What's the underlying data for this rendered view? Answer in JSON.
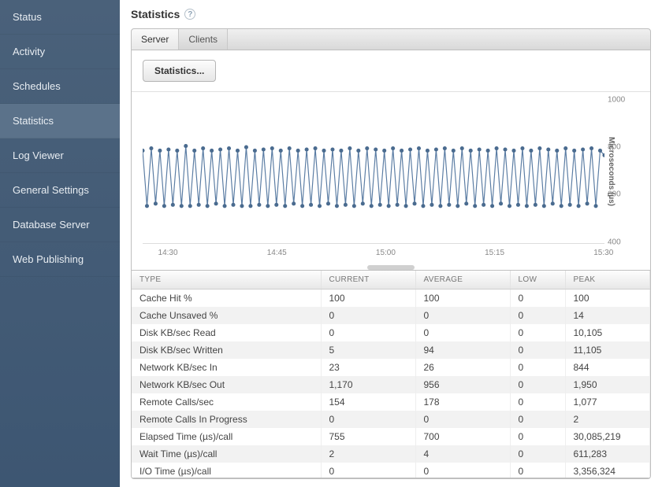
{
  "sidebar": {
    "items": [
      {
        "label": "Status"
      },
      {
        "label": "Activity"
      },
      {
        "label": "Schedules"
      },
      {
        "label": "Statistics",
        "active": true
      },
      {
        "label": "Log Viewer"
      },
      {
        "label": "General Settings"
      },
      {
        "label": "Database Server"
      },
      {
        "label": "Web Publishing"
      }
    ]
  },
  "page": {
    "title": "Statistics"
  },
  "tabs": [
    {
      "label": "Server",
      "active": true
    },
    {
      "label": "Clients"
    }
  ],
  "toolbar": {
    "stats_button": "Statistics..."
  },
  "chart_data": {
    "type": "line",
    "ylabel": "Microseconds (µs)",
    "ylim": [
      400,
      1000
    ],
    "yticks": [
      400,
      600,
      800,
      1000
    ],
    "x_ticks": [
      "14:30",
      "14:45",
      "15:00",
      "15:15",
      "15:30"
    ],
    "values": [
      780,
      540,
      790,
      550,
      780,
      540,
      785,
      545,
      780,
      540,
      800,
      540,
      780,
      545,
      790,
      540,
      780,
      550,
      785,
      540,
      790,
      545,
      780,
      540,
      795,
      540,
      780,
      545,
      785,
      540,
      790,
      545,
      780,
      540,
      790,
      550,
      780,
      540,
      785,
      545,
      790,
      540,
      780,
      550,
      785,
      540,
      780,
      545,
      790,
      540,
      780,
      550,
      790,
      540,
      785,
      545,
      780,
      540,
      790,
      545,
      780,
      540,
      785,
      550,
      790,
      540,
      780,
      545,
      785,
      540,
      790,
      545,
      780,
      540,
      790,
      550,
      780,
      540,
      785,
      545,
      780,
      540,
      790,
      550,
      785,
      540,
      780,
      545,
      790,
      540,
      780,
      545,
      790,
      540,
      785,
      550,
      780,
      540,
      790,
      545,
      780,
      540,
      785,
      550,
      790,
      540,
      780,
      760
    ]
  },
  "table": {
    "columns": [
      "TYPE",
      "CURRENT",
      "AVERAGE",
      "LOW",
      "PEAK"
    ],
    "rows": [
      {
        "type": "Cache Hit %",
        "current": "100",
        "average": "100",
        "low": "0",
        "peak": "100"
      },
      {
        "type": "Cache Unsaved %",
        "current": "0",
        "average": "0",
        "low": "0",
        "peak": "14"
      },
      {
        "type": "Disk KB/sec Read",
        "current": "0",
        "average": "0",
        "low": "0",
        "peak": "10,105"
      },
      {
        "type": "Disk KB/sec Written",
        "current": "5",
        "average": "94",
        "low": "0",
        "peak": "11,105"
      },
      {
        "type": "Network KB/sec In",
        "current": "23",
        "average": "26",
        "low": "0",
        "peak": "844"
      },
      {
        "type": "Network KB/sec Out",
        "current": "1,170",
        "average": "956",
        "low": "0",
        "peak": "1,950"
      },
      {
        "type": "Remote Calls/sec",
        "current": "154",
        "average": "178",
        "low": "0",
        "peak": "1,077"
      },
      {
        "type": "Remote Calls In Progress",
        "current": "0",
        "average": "0",
        "low": "0",
        "peak": "2"
      },
      {
        "type": "Elapsed Time (µs)/call",
        "current": "755",
        "average": "700",
        "low": "0",
        "peak": "30,085,219"
      },
      {
        "type": "Wait Time (µs)/call",
        "current": "2",
        "average": "4",
        "low": "0",
        "peak": "611,283"
      },
      {
        "type": "I/O Time (µs)/call",
        "current": "0",
        "average": "0",
        "low": "0",
        "peak": "3,356,324"
      }
    ]
  }
}
